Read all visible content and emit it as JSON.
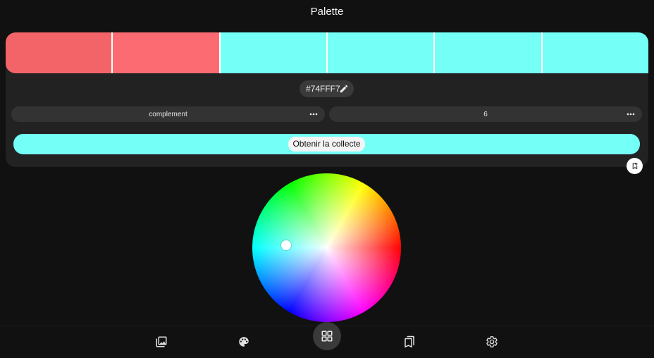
{
  "header": {
    "title": "Palette"
  },
  "palette": {
    "swatches": [
      "#f36468",
      "#fb6b71",
      "#74fff7",
      "#74fff7",
      "#74fff7",
      "#74fff7"
    ],
    "base_hex": "#74FFF7",
    "accent_color": "#74fff7"
  },
  "controls": {
    "scheme": "complement",
    "count": "6",
    "more_icon": "more-horizontal-icon"
  },
  "action": {
    "get_collection_label": "Obtenir la collecte"
  },
  "bottom_nav": {
    "items": [
      "image-gallery-icon",
      "palette-icon",
      "grid-icon",
      "bookmarks-icon",
      "settings-gear-icon"
    ],
    "active": "grid-icon"
  }
}
